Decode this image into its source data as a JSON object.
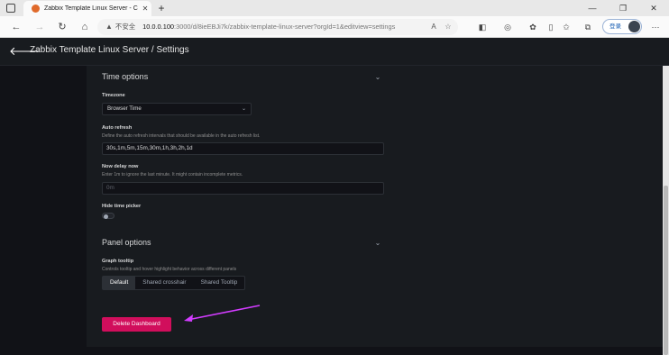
{
  "browser": {
    "tab_title": "Zabbix Template Linux Server - C",
    "address": {
      "security": "不安全",
      "host": "10.0.0.100",
      "path": ":3000/d/8ieEBJi7k/zabbix-template-linux-server?orgId=1&editview=settings"
    },
    "login_label": "登录"
  },
  "app": {
    "page_title": "Zabbix Template Linux Server / Settings"
  },
  "time_options": {
    "heading": "Time options",
    "timezone": {
      "label": "Timezone",
      "value": "Browser Time"
    },
    "auto_refresh": {
      "label": "Auto refresh",
      "description": "Define the auto refresh intervals that should be available in the auto refresh list.",
      "value": "30s,1m,5m,15m,30m,1h,3h,2h,1d"
    },
    "now_delay": {
      "label": "Now delay now",
      "description": "Enter 1m to ignore the last minute. It might contain incomplete metrics.",
      "placeholder": "0m"
    },
    "hide_time_picker": {
      "label": "Hide time picker",
      "enabled": false
    }
  },
  "panel_options": {
    "heading": "Panel options",
    "graph_tooltip": {
      "label": "Graph tooltip",
      "description": "Controls tooltip and hover highlight behavior across different panels",
      "options": [
        "Default",
        "Shared crosshair",
        "Shared Tooltip"
      ],
      "selected": "Default"
    }
  },
  "delete_button": "Delete Dashboard",
  "colors": {
    "danger": "#d10e5c",
    "annotation_arrow": "#d23cff",
    "background": "#111217",
    "panel": "#181b1f"
  }
}
